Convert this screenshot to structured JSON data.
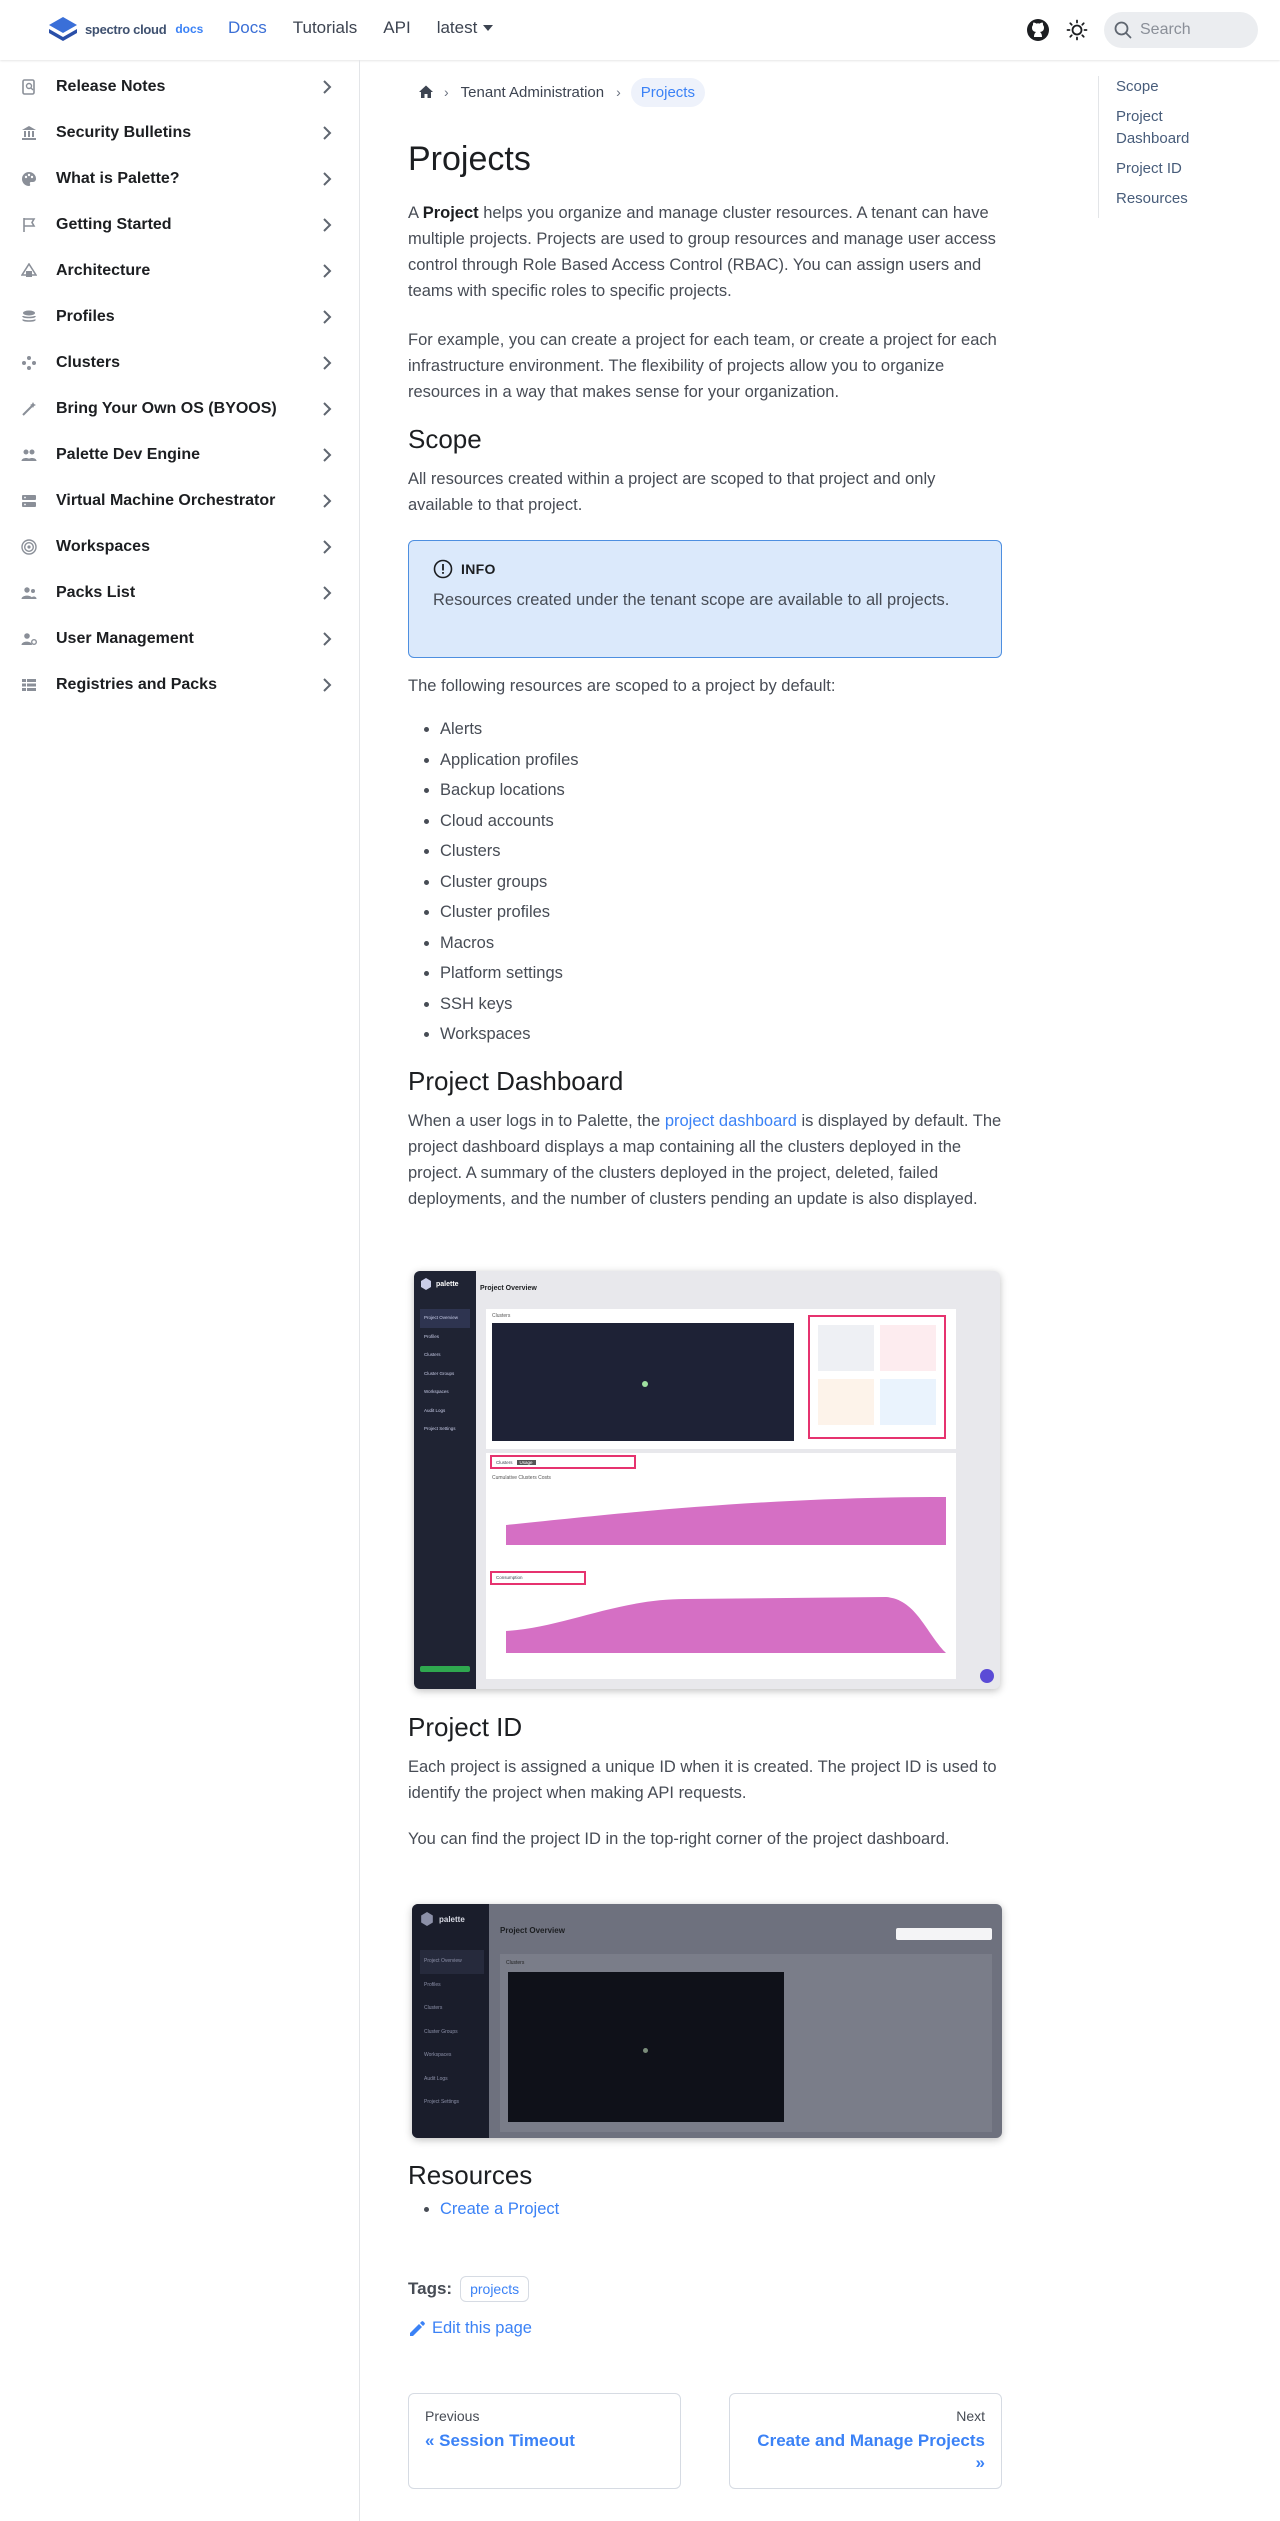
{
  "navbar": {
    "brand": "spectro cloud",
    "brand_suffix": "docs",
    "links": [
      "Docs",
      "Tutorials",
      "API",
      "latest"
    ],
    "search_placeholder": "Search"
  },
  "sidebar": {
    "items": [
      {
        "label": "Release Notes",
        "icon": "release-notes-icon"
      },
      {
        "label": "Security Bulletins",
        "icon": "bank-icon"
      },
      {
        "label": "What is Palette?",
        "icon": "palette-icon"
      },
      {
        "label": "Getting Started",
        "icon": "flag-icon"
      },
      {
        "label": "Architecture",
        "icon": "architecture-icon"
      },
      {
        "label": "Profiles",
        "icon": "layers-icon"
      },
      {
        "label": "Clusters",
        "icon": "clusters-icon"
      },
      {
        "label": "Bring Your Own OS (BYOOS)",
        "icon": "wand-icon"
      },
      {
        "label": "Palette Dev Engine",
        "icon": "users-icon"
      },
      {
        "label": "Virtual Machine Orchestrator",
        "icon": "server-icon"
      },
      {
        "label": "Workspaces",
        "icon": "target-icon"
      },
      {
        "label": "Packs List",
        "icon": "people-icon"
      },
      {
        "label": "User Management",
        "icon": "user-gear-icon"
      },
      {
        "label": "Registries and Packs",
        "icon": "grid-icon"
      }
    ]
  },
  "breadcrumb": {
    "section": "Tenant Administration",
    "current": "Projects"
  },
  "page": {
    "title": "Projects",
    "intro_prefix": "A",
    "intro_bold": "Project",
    "intro_rest": "helps you organize and manage cluster resources. A tenant can have multiple projects. Projects are used to group resources and manage user access control through Role Based Access Control (RBAC). You can assign users and teams with specific roles to specific projects.",
    "intro2": "For example, you can create a project for each team, or create a project for each infrastructure environment. The flexibility of projects allow you to organize resources in a way that makes sense for your organization.",
    "scope_heading": "Scope",
    "scope_text": "All resources created within a project are scoped to that project and only available to that project.",
    "info_label": "INFO",
    "info_text": "Resources created under the tenant scope are available to all projects.",
    "scoped_intro": "The following resources are scoped to a project by default:",
    "scoped_list": [
      "Alerts",
      "Application profiles",
      "Backup locations",
      "Cloud accounts",
      "Clusters",
      "Cluster groups",
      "Cluster profiles",
      "Macros",
      "Platform settings",
      "SSH keys",
      "Workspaces"
    ],
    "dashboard_heading": "Project Dashboard",
    "dashboard_prefix": "When a user logs in to Palette, the",
    "dashboard_link": "project dashboard",
    "dashboard_rest": "is displayed by default. The project dashboard displays a map containing all the clusters deployed in the project. A summary of the clusters deployed in the project, deleted, failed deployments, and the number of clusters pending an update is also displayed.",
    "projectid_heading": "Project ID",
    "projectid_text1": "Each project is assigned a unique ID when it is created. The project ID is used to identify the project when making API requests.",
    "projectid_text2": "You can find the project ID in the top-right corner of the project dashboard.",
    "resources_heading": "Resources",
    "resources_link": "Create a Project",
    "tags_label": "Tags:",
    "tag": "projects",
    "edit_link": "Edit this page",
    "prev_label": "Previous",
    "prev_title": "« Session Timeout",
    "next_label": "Next",
    "next_title": "Create and Manage Projects »"
  },
  "screenshot1": {
    "brand": "palette",
    "title": "Project Overview",
    "map_label": "Clusters",
    "nav": [
      "Project Overview",
      "Profiles",
      "Clusters",
      "Cluster Groups",
      "Workspaces",
      "Audit Logs",
      "Project Settings"
    ],
    "tabs": [
      "Clusters",
      "Usage"
    ],
    "chart1_title": "Cumulative Clusters Costs",
    "chart2_title": "Consumption"
  },
  "screenshot2": {
    "brand": "palette",
    "title": "Project Overview",
    "map_label": "Clusters",
    "nav": [
      "Project Overview",
      "Profiles",
      "Clusters",
      "Cluster Groups",
      "Workspaces",
      "Audit Logs",
      "Project Settings"
    ]
  },
  "toc": {
    "items": [
      "Scope",
      "Project Dashboard",
      "Project ID",
      "Resources"
    ]
  },
  "colors": {
    "accent": "#3b82f6",
    "info_bg": "#dbe9fb",
    "highlight": "#e6336f",
    "chart_fill": "#d56fc4"
  }
}
